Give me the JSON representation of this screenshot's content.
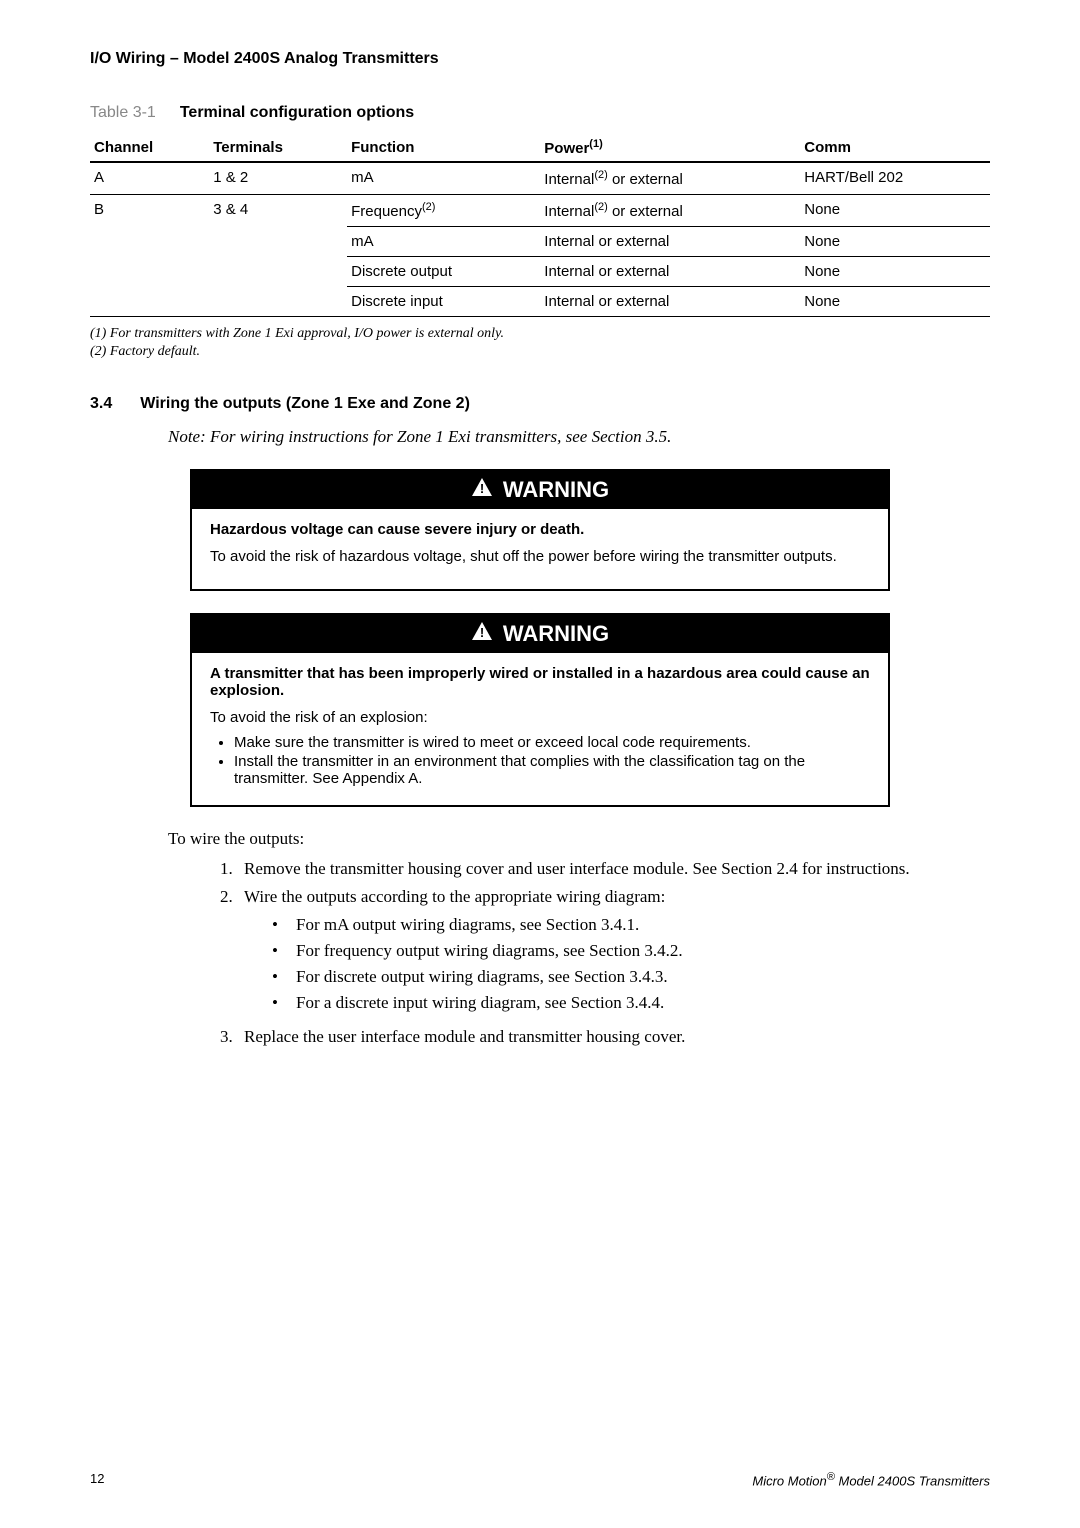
{
  "section_header": "I/O Wiring – Model 2400S Analog Transmitters",
  "table": {
    "id": "Table 3-1",
    "title": "Terminal configuration options",
    "headers": {
      "channel": "Channel",
      "terminals": "Terminals",
      "function": "Function",
      "power": "Power",
      "power_sup": "(1)",
      "comm": "Comm"
    },
    "row_a": {
      "channel": "A",
      "terminals": "1 & 2",
      "function": "mA",
      "power_pre": "Internal",
      "power_sup": "(2)",
      "power_post": " or external",
      "comm": "HART/Bell 202"
    },
    "row_b1": {
      "channel": "B",
      "terminals": "3 & 4",
      "function_pre": "Frequency",
      "function_sup": "(2)",
      "power_pre": "Internal",
      "power_sup": "(2)",
      "power_post": " or external",
      "comm": "None"
    },
    "row_b2": {
      "function": "mA",
      "power": "Internal or external",
      "comm": "None"
    },
    "row_b3": {
      "function": "Discrete output",
      "power": "Internal or external",
      "comm": "None"
    },
    "row_b4": {
      "function": "Discrete input",
      "power": "Internal or external",
      "comm": "None"
    },
    "footnotes": {
      "f1": "(1) For transmitters with Zone 1 Exi approval, I/O power is external only.",
      "f2": "(2) Factory default."
    }
  },
  "section34": {
    "num": "3.4",
    "title": "Wiring the outputs (Zone 1 Exe and Zone 2)",
    "note": "Note: For wiring instructions for Zone 1 Exi transmitters, see Section 3.5."
  },
  "warning_label": "WARNING",
  "warn1": {
    "lead": "Hazardous voltage can cause severe injury or death.",
    "body": "To avoid the risk of hazardous voltage, shut off the power before wiring the transmitter outputs."
  },
  "warn2": {
    "lead": "A transmitter that has been improperly wired or installed in a hazardous area could cause an explosion.",
    "body": "To avoid the risk of an explosion:",
    "li1": "Make sure the transmitter is wired to meet or exceed local code requirements.",
    "li2": "Install the transmitter in an environment that complies with the classification tag on the transmitter. See Appendix A."
  },
  "steps": {
    "intro": "To wire the outputs:",
    "s1": "Remove the transmitter housing cover and user interface module. See Section 2.4 for instructions.",
    "s2": "Wire the outputs according to the appropriate wiring diagram:",
    "s2a": "For mA output wiring diagrams, see Section 3.4.1.",
    "s2b": "For frequency output wiring diagrams, see Section 3.4.2.",
    "s2c": "For discrete output wiring diagrams, see Section 3.4.3.",
    "s2d": "For a discrete input wiring diagram, see Section 3.4.4.",
    "s3": "Replace the user interface module and transmitter housing cover."
  },
  "footer": {
    "page": "12",
    "title_pre": "Micro Motion",
    "title_sup": "®",
    "title_post": " Model 2400S Transmitters"
  }
}
